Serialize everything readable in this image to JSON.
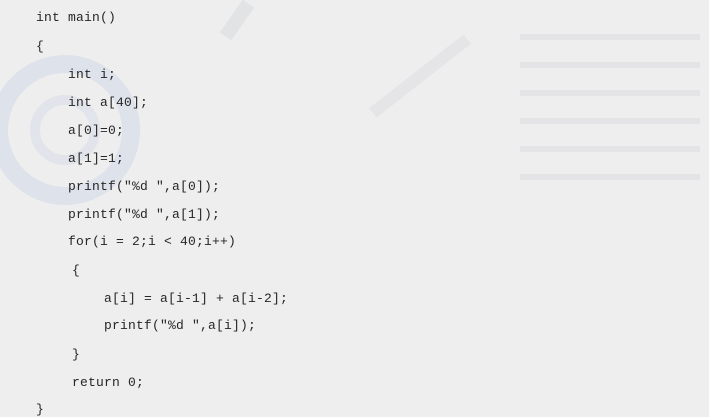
{
  "code": {
    "lines": [
      "int main()",
      "{",
      "int i;",
      "int a[40];",
      "a[0]=0;",
      "a[1]=1;",
      "printf(\"%d \",a[0]);",
      "printf(\"%d \",a[1]);",
      "for(i = 2;i < 40;i++)",
      "{",
      "a[i] = a[i-1] + a[i-2];",
      "printf(\"%d \",a[i]);",
      "}",
      "return 0;",
      "}"
    ]
  }
}
